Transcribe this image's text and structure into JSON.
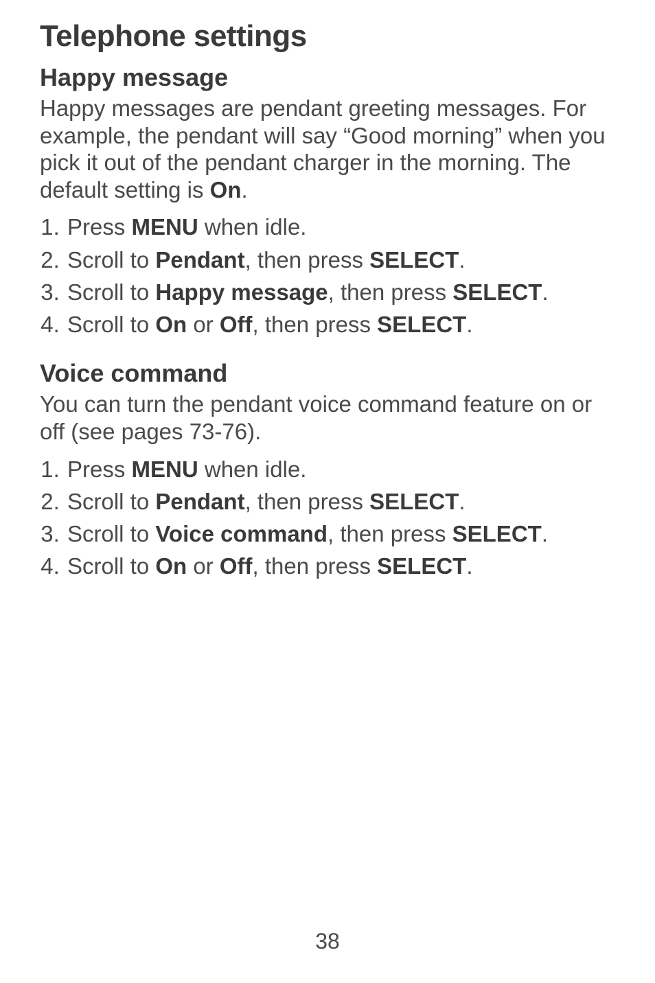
{
  "page_title": "Telephone settings",
  "section1": {
    "heading": "Happy message",
    "body_parts": [
      "Happy messages are pendant greeting messages. For example, the pendant will say “Good morning” when you pick it out of the pendant charger in the morning. The default setting is ",
      "On",
      "."
    ],
    "steps": [
      [
        "Press ",
        "MENU",
        " when idle."
      ],
      [
        "Scroll to ",
        "Pendant",
        ", then press ",
        "SELECT",
        "."
      ],
      [
        "Scroll to ",
        "Happy message",
        ", then press ",
        "SELECT",
        "."
      ],
      [
        "Scroll to ",
        "On",
        " or ",
        "Off",
        ", then press ",
        "SELECT",
        "."
      ]
    ]
  },
  "section2": {
    "heading": "Voice command",
    "body_parts": [
      "You can turn the pendant voice command feature on or off (see pages 73-76)."
    ],
    "steps": [
      [
        "Press ",
        "MENU",
        " when idle."
      ],
      [
        "Scroll to ",
        "Pendant",
        ", then press ",
        "SELECT",
        "."
      ],
      [
        "Scroll to ",
        "Voice command",
        ", then press ",
        "SELECT",
        "."
      ],
      [
        "Scroll to ",
        "On",
        " or ",
        "Off",
        ", then press ",
        "SELECT",
        "."
      ]
    ]
  },
  "page_number": "38"
}
